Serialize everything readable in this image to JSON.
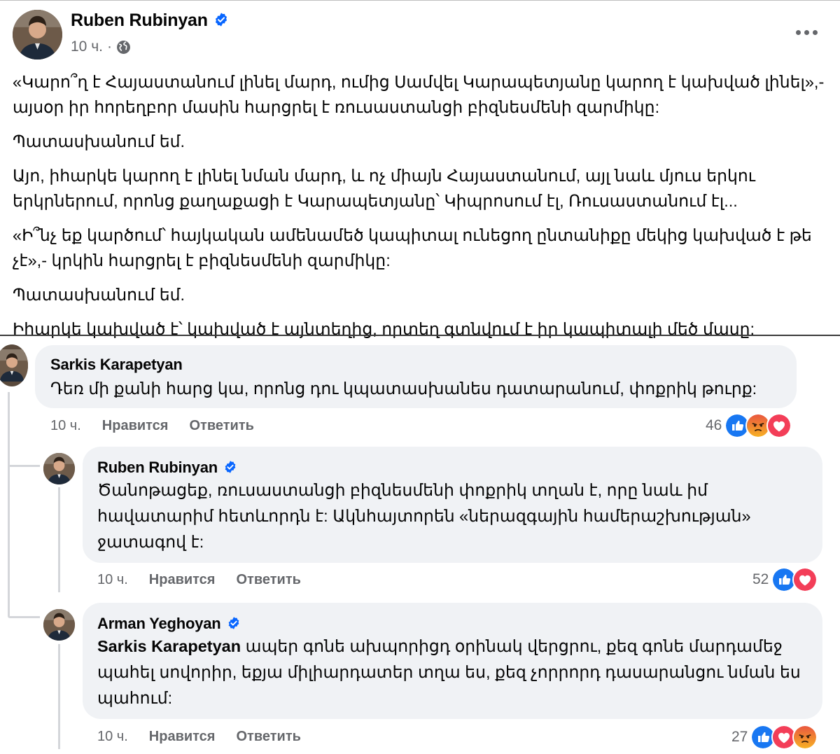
{
  "post": {
    "author": "Ruben Rubinyan",
    "time": "10 ч.",
    "separator": "·",
    "paragraphs": [
      "«Կարո՞ղ է Հայաստանում լինել մարդ, ումից Սամվել Կարապետյանը կարող է կախված լինել»,- այսօր իր հորեղբոր մասին հարցրել է ռուսաստանցի բիզնեսմենի զարմիկը:",
      "Պատասխանում եմ.",
      "Այո, իհարկե կարող է լինել նման մարդ, և ոչ միայն Հայաստանում, այլ նաև մյուս երկու երկրներում, որոնց քաղաքացի է Կարապետյանը՝ Կիպրոսում էլ, Ռուսաստանում էլ...",
      "«Ի՞նչ եք կարծում՝ հայկական ամենամեծ կապիտալ ունեցող ընտանիքը մեկից կախված է թե չէ»,- կրկին հարցրել է բիզնեսմենի  զարմիկը:",
      "Պատասխանում եմ.",
      "Իհարկե կախված է՝ կախված է այնտեղից, որտեղ գտնվում է իր կապիտալի մեծ մասը:"
    ]
  },
  "colors": {
    "accent": "#0866ff",
    "bubble": "#f0f2f5",
    "secondary_text": "#65676b"
  },
  "comments": [
    {
      "author": "Sarkis Karapetyan",
      "mention": "",
      "text": "Դեռ մի քանի հարց կա, որոնց դու կպատասխանես դատարանում, փոքրիկ թուրք:",
      "time": "10 ч.",
      "like_label": "Нравится",
      "reply_label": "Ответить",
      "reaction_count": "46",
      "reactions": [
        "like-icon",
        "angry-icon",
        "love-icon"
      ]
    },
    {
      "author": "Ruben Rubinyan",
      "mention": "",
      "text": "Ծանոթացեք, ռուսաստանցի բիզնեսմենի փոքրիկ տղան է, որը նաև իմ հավատարիմ հետևորդն է: Ակնհայտորեն «ներազգային համերաշխության» ջատագով է:",
      "time": "10 ч.",
      "like_label": "Нравится",
      "reply_label": "Ответить",
      "reaction_count": "52",
      "reactions": [
        "like-icon",
        "love-icon"
      ]
    },
    {
      "author": "Arman Yeghoyan",
      "mention": "Sarkis Karapetyan",
      "text": " ապեր գոնե ախպորիցդ օրինակ վերցրու, քեզ գոնե մարդամեջ պահել սովորիր, եքյա միլիարդատեր տղա ես, քեզ չորրորդ դասարանցու նման ես պահում:",
      "time": "10 ч.",
      "like_label": "Нравится",
      "reply_label": "Ответить",
      "reaction_count": "27",
      "reactions": [
        "like-icon",
        "love-icon",
        "angry-icon"
      ]
    }
  ]
}
